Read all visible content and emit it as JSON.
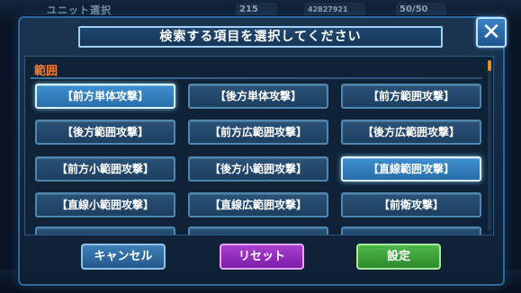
{
  "hud": {
    "title": "ユニット選択",
    "stamina": "215",
    "coins": "42827921",
    "energy": "50/50"
  },
  "dialog": {
    "title": "検索する項目を選択してください",
    "close_icon_glyph": "✕"
  },
  "section": {
    "label": "範囲"
  },
  "options": [
    {
      "label": "【前方単体攻撃】",
      "selected": true
    },
    {
      "label": "【後方単体攻撃】",
      "selected": false
    },
    {
      "label": "【前方範囲攻撃】",
      "selected": false
    },
    {
      "label": "【後方範囲攻撃】",
      "selected": false
    },
    {
      "label": "【前方広範囲攻撃】",
      "selected": false
    },
    {
      "label": "【後方広範囲攻撃】",
      "selected": false
    },
    {
      "label": "【前方小範囲攻撃】",
      "selected": false
    },
    {
      "label": "【後方小範囲攻撃】",
      "selected": false
    },
    {
      "label": "【直線範囲攻撃】",
      "selected": true
    },
    {
      "label": "【直線小範囲攻撃】",
      "selected": false
    },
    {
      "label": "【直線広範囲攻撃】",
      "selected": false
    },
    {
      "label": "【前衛攻撃】",
      "selected": false
    }
  ],
  "buttons": {
    "cancel": "キャンセル",
    "reset": "リセット",
    "set": "設定"
  },
  "colors": {
    "section_label": "#ff7b2c",
    "selected_option": "#3e8fd0",
    "cancel": "#3f7fb8",
    "reset": "#a93fd0",
    "set": "#4fb84a"
  }
}
